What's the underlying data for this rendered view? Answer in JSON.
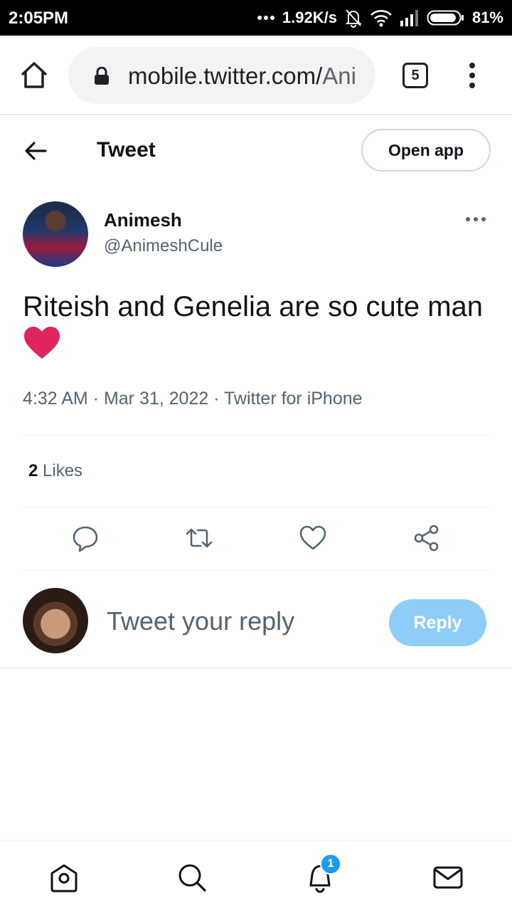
{
  "status_bar": {
    "time": "2:05PM",
    "network_speed": "1.92K/s",
    "battery": "81%",
    "icons": [
      "dots-icon",
      "bell-off-icon",
      "wifi-icon",
      "signal-icon",
      "battery-icon"
    ]
  },
  "browser": {
    "url_host": "mobile.twitter.com/",
    "url_path": "Ani",
    "tab_count": "5"
  },
  "header": {
    "title": "Tweet",
    "open_app_label": "Open app"
  },
  "tweet": {
    "author_name": "Animesh",
    "author_handle": "@AnimeshCule",
    "text": "Riteish and Genelia are so cute man",
    "meta": "4:32 AM · Mar 31, 2022 · Twitter for iPhone",
    "likes_count": "2",
    "likes_label": "Likes"
  },
  "actions": [
    "reply-icon",
    "retweet-icon",
    "like-icon",
    "share-icon"
  ],
  "composer": {
    "placeholder": "Tweet your reply",
    "reply_label": "Reply"
  },
  "bottom_nav": {
    "items": [
      "home-icon",
      "search-icon",
      "notifications-icon",
      "messages-icon"
    ],
    "notification_badge": "1"
  },
  "colors": {
    "accent": "#1d9bf0",
    "reply_button": "#8ecdf8",
    "secondary_text": "#536471",
    "heart": "#e0245e"
  }
}
